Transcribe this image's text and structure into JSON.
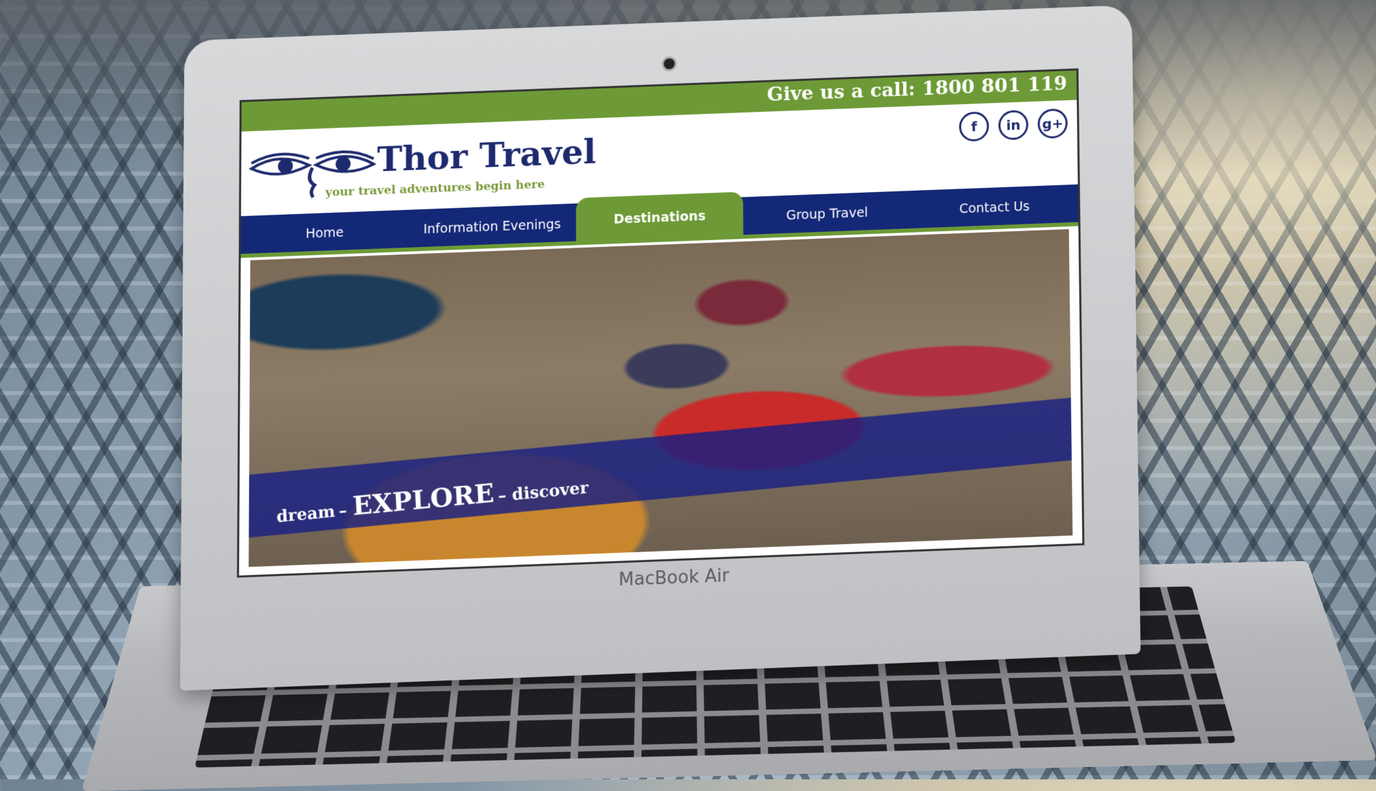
{
  "device": {
    "brand_label": "MacBook Air"
  },
  "site": {
    "phone_text": "Give us a call: 1800 801 119",
    "logo_title": "Thor Travel",
    "logo_tagline": "your travel adventures begin here",
    "social": [
      {
        "label": "f",
        "icon": "facebook-icon"
      },
      {
        "label": "in",
        "icon": "linkedin-icon"
      },
      {
        "label": "g+",
        "icon": "google-plus-icon"
      }
    ],
    "nav": [
      {
        "label": "Home",
        "active": false
      },
      {
        "label": "Information Evenings",
        "active": false
      },
      {
        "label": "Destinations",
        "active": true
      },
      {
        "label": "Group Travel",
        "active": false
      },
      {
        "label": "Contact Us",
        "active": false
      }
    ],
    "hero": {
      "word1": "dream",
      "word2": "EXPLORE",
      "word3": "discover"
    }
  },
  "colors": {
    "brand_green": "#6d9a36",
    "brand_navy": "#142878"
  }
}
